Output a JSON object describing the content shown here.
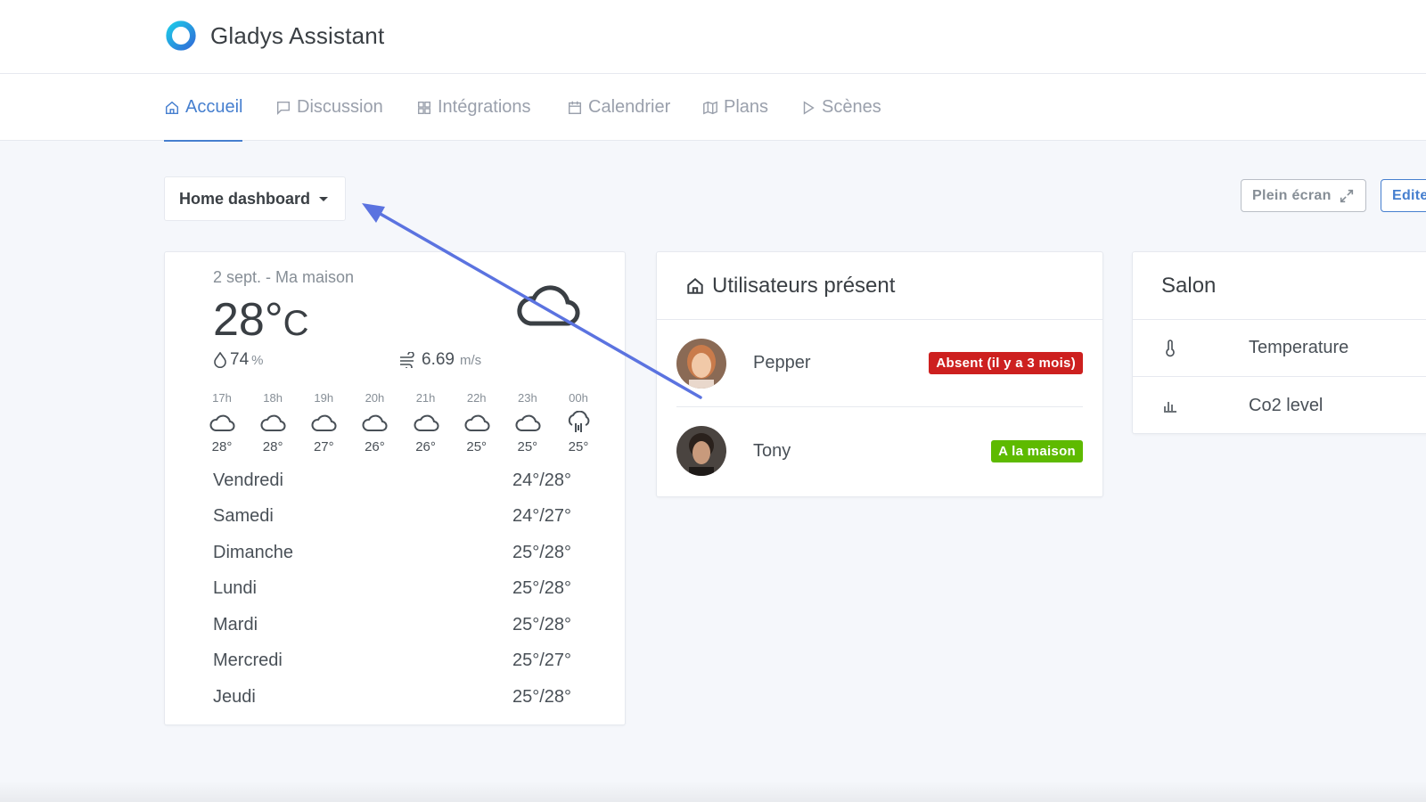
{
  "app": {
    "title": "Gladys Assistant"
  },
  "nav": [
    {
      "label": "Accueil",
      "icon": "home-icon",
      "active": true
    },
    {
      "label": "Discussion",
      "icon": "chat-icon",
      "active": false
    },
    {
      "label": "Intégrations",
      "icon": "grid-icon",
      "active": false
    },
    {
      "label": "Calendrier",
      "icon": "calendar-icon",
      "active": false
    },
    {
      "label": "Plans",
      "icon": "map-icon",
      "active": false
    },
    {
      "label": "Scènes",
      "icon": "play-icon",
      "active": false
    }
  ],
  "dashboard": {
    "selected": "Home dashboard",
    "fullscreen_label": "Plein écran",
    "edit_label": "Edite"
  },
  "weather": {
    "date_location": "2 sept. - Ma maison",
    "temperature": "28°",
    "unit": "C",
    "humidity": "74",
    "humidity_unit": "%",
    "wind": "6.69",
    "wind_unit": "m/s",
    "hours": [
      {
        "time": "17h",
        "temp": "28°",
        "icon": "cloud-icon"
      },
      {
        "time": "18h",
        "temp": "28°",
        "icon": "cloud-icon"
      },
      {
        "time": "19h",
        "temp": "27°",
        "icon": "cloud-icon"
      },
      {
        "time": "20h",
        "temp": "26°",
        "icon": "cloud-icon"
      },
      {
        "time": "21h",
        "temp": "26°",
        "icon": "cloud-icon"
      },
      {
        "time": "22h",
        "temp": "25°",
        "icon": "cloud-icon"
      },
      {
        "time": "23h",
        "temp": "25°",
        "icon": "cloud-icon"
      },
      {
        "time": "00h",
        "temp": "25°",
        "icon": "rain-icon"
      }
    ],
    "days": [
      {
        "day": "Vendredi",
        "range": "24°/28°"
      },
      {
        "day": "Samedi",
        "range": "24°/27°"
      },
      {
        "day": "Dimanche",
        "range": "25°/28°"
      },
      {
        "day": "Lundi",
        "range": "25°/28°"
      },
      {
        "day": "Mardi",
        "range": "25°/28°"
      },
      {
        "day": "Mercredi",
        "range": "25°/27°"
      },
      {
        "day": "Jeudi",
        "range": "25°/28°"
      }
    ]
  },
  "users_card": {
    "title": "Utilisateurs présent",
    "users": [
      {
        "name": "Pepper",
        "status": "Absent (il y a 3 mois)",
        "status_color": "#cd201f"
      },
      {
        "name": "Tony",
        "status": "A la maison",
        "status_color": "#5eba00"
      }
    ]
  },
  "salon_card": {
    "title": "Salon",
    "sensors": [
      {
        "name": "Temperature",
        "icon": "thermometer-icon"
      },
      {
        "name": "Co2 level",
        "icon": "bar-chart-icon"
      }
    ]
  },
  "colors": {
    "accent": "#467fcf",
    "annotation_arrow": "#5b73e0"
  }
}
